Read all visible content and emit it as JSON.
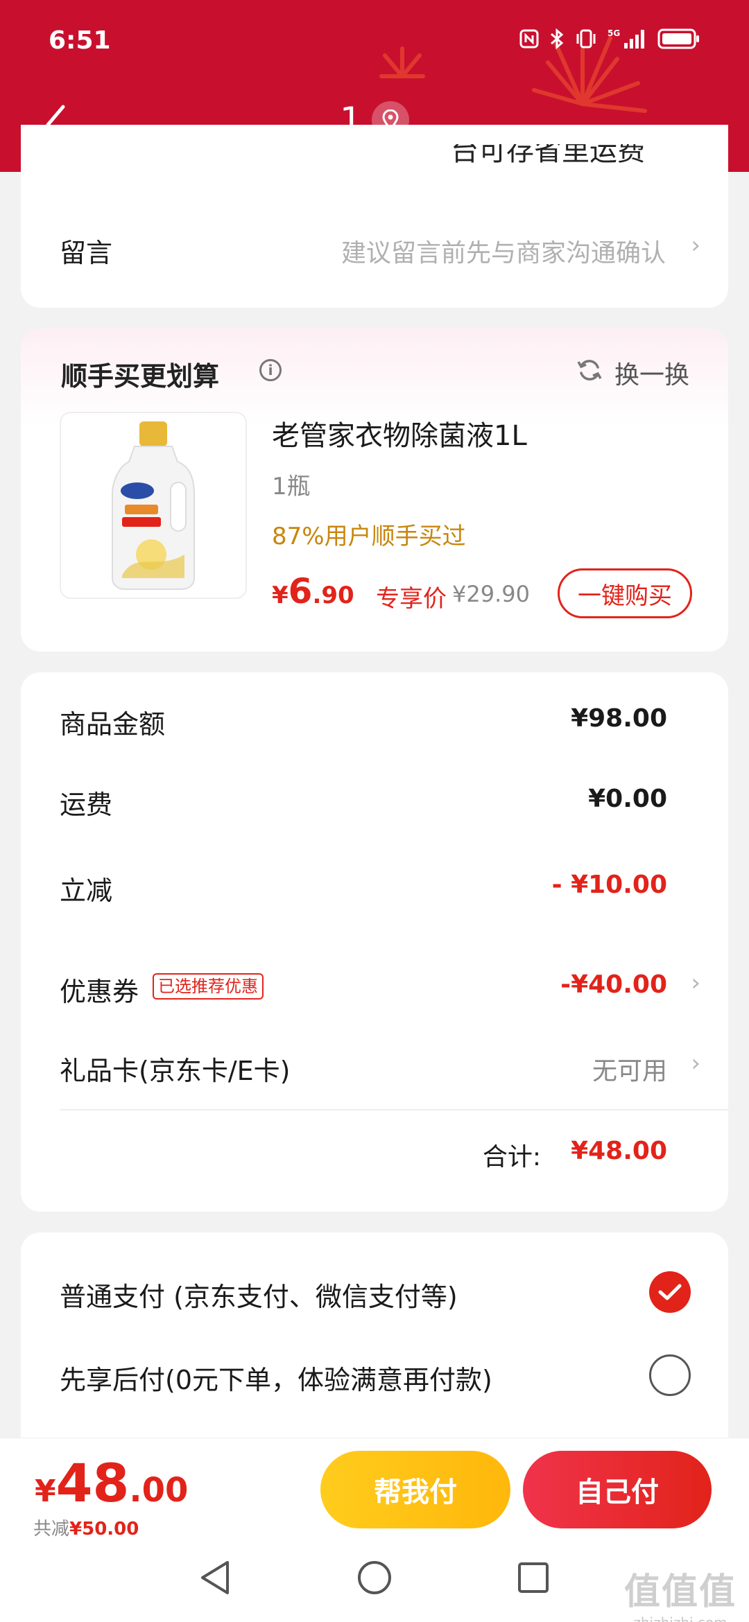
{
  "status_bar": {
    "time": "6:51"
  },
  "nav": {
    "title": "1"
  },
  "message_card": {
    "cut_text": "台可存省里运费",
    "label": "留言",
    "placeholder": "建议留言前先与商家沟通确认"
  },
  "upsell": {
    "title": "顺手买更划算",
    "swap_label": "换一换",
    "product": {
      "name": "老管家衣物除菌液1L",
      "qty": "1瓶",
      "social": "87%用户顺手买过",
      "price_currency": "¥",
      "price_int": "6",
      "price_dec": ".90",
      "exclusive_label": "专享价",
      "original_price": "¥29.90",
      "buy_label": "一键购买"
    }
  },
  "summary": {
    "goods_label": "商品金额",
    "goods_value": "¥98.00",
    "shipping_label": "运费",
    "shipping_value": "¥0.00",
    "discount_label": "立减",
    "discount_value": "- ¥10.00",
    "coupon_label": "优惠券",
    "coupon_tag": "已选推荐优惠",
    "coupon_value": "-¥40.00",
    "giftcard_label": "礼品卡(京东卡/E卡)",
    "giftcard_value": "无可用",
    "total_label": "合计:",
    "total_value": "¥48.00"
  },
  "payment": {
    "option1": "普通支付 (京东支付、微信支付等)",
    "option1_selected": true,
    "option2": "先享后付(0元下单，体验满意再付款)",
    "option2_selected": false
  },
  "bottom": {
    "price_currency": "¥",
    "price_int": "48",
    "price_dec": ".00",
    "saved_label": "共减",
    "saved_value": "¥50.00",
    "help_pay": "帮我付",
    "self_pay": "自己付"
  },
  "watermark": {
    "big": "值值值",
    "small": "zhizhizhi.com"
  },
  "colors": {
    "header": "#c8102e",
    "accent": "#e2231a",
    "gold": "#c8860d",
    "yellow": "#ffcc1d"
  }
}
